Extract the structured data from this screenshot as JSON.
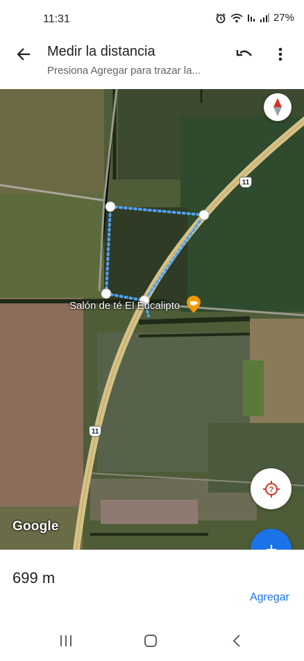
{
  "status_bar": {
    "time": "11:31",
    "battery": "27%",
    "icons": [
      "alarm-icon",
      "wifi-icon",
      "lte-icon",
      "signal-icon",
      "battery-icon"
    ]
  },
  "app_bar": {
    "title": "Medir la distancia",
    "subtitle": "Presiona Agregar para trazar la...",
    "icons": [
      "back-arrow-icon",
      "undo-icon",
      "more-vert-icon"
    ]
  },
  "map": {
    "place_label": "Salón de té El Eucalipto",
    "route_number": "11",
    "attribution": "Google",
    "colors": {
      "measure_line": "#4fa3f7",
      "road": "#d6c186",
      "accent": "#1a73e8",
      "poi": "#f29900"
    }
  },
  "panel": {
    "distance": "699 m",
    "add_label": "Agregar"
  },
  "nav_bar": {
    "icons": [
      "recents-icon",
      "home-icon",
      "back-icon"
    ]
  }
}
